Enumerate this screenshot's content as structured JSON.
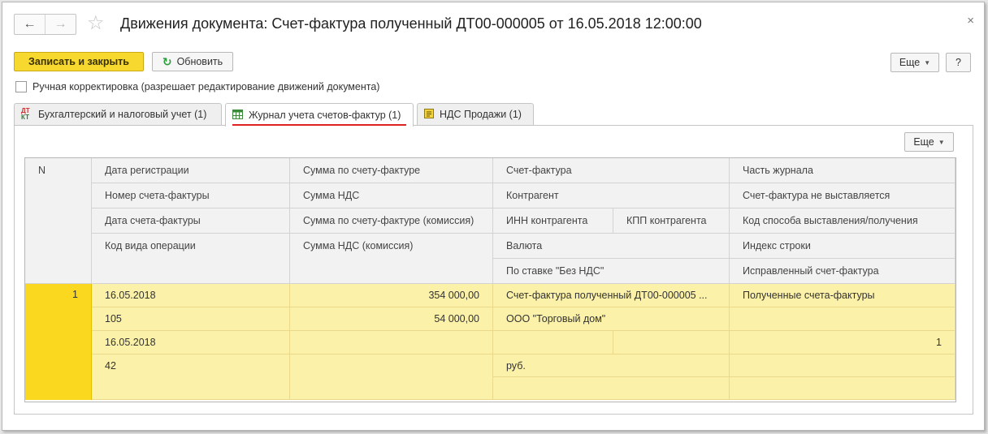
{
  "window": {
    "title": "Движения документа: Счет-фактура полученный ДТ00-000005 от 16.05.2018 12:00:00",
    "back_icon": "←",
    "forward_icon": "→",
    "star_icon": "☆",
    "close_icon": "×"
  },
  "toolbar": {
    "save_close": "Записать и закрыть",
    "refresh": "Обновить",
    "refresh_icon": "↻",
    "more": "Еще",
    "help": "?"
  },
  "manual_correction": {
    "label": "Ручная корректировка (разрешает редактирование движений документа)",
    "checked": false
  },
  "tabs": [
    {
      "label": "Бухгалтерский и налоговый учет (1)",
      "icon": "dt-kt-icon",
      "active": false
    },
    {
      "label": "Журнал учета счетов-фактур (1)",
      "icon": "table-icon",
      "active": true
    },
    {
      "label": "НДС Продажи (1)",
      "icon": "register-icon",
      "active": false
    }
  ],
  "table_toolbar": {
    "more": "Еще"
  },
  "table": {
    "header": {
      "n": "N",
      "c1": [
        "Дата регистрации",
        "Номер счета-фактуры",
        "Дата счета-фактуры",
        "Код вида операции"
      ],
      "c2": [
        "Сумма по счету-фактуре",
        "Сумма НДС",
        "Сумма по счету-фактуре (комиссия)",
        "Сумма НДС (комиссия)"
      ],
      "c3": [
        "Счет-фактура",
        "Контрагент",
        "ИНН контрагента",
        "КПП контрагента",
        "Валюта",
        "По ставке \"Без НДС\""
      ],
      "c4": [
        "Часть журнала",
        "Счет-фактура не выставляется",
        "Код способа выставления/получения",
        "Индекс строки",
        "Исправленный счет-фактура"
      ]
    },
    "rows": [
      {
        "n": "1",
        "c1": [
          "16.05.2018",
          "105",
          "16.05.2018",
          "42"
        ],
        "c2": [
          "354 000,00",
          "54 000,00",
          "",
          ""
        ],
        "c3": [
          "Счет-фактура полученный ДТ00-000005 ...",
          "ООО \"Торговый дом\"",
          "",
          "",
          "руб.",
          ""
        ],
        "c4": [
          "Полученные счета-фактуры",
          "",
          "1",
          "",
          ""
        ]
      }
    ]
  }
}
